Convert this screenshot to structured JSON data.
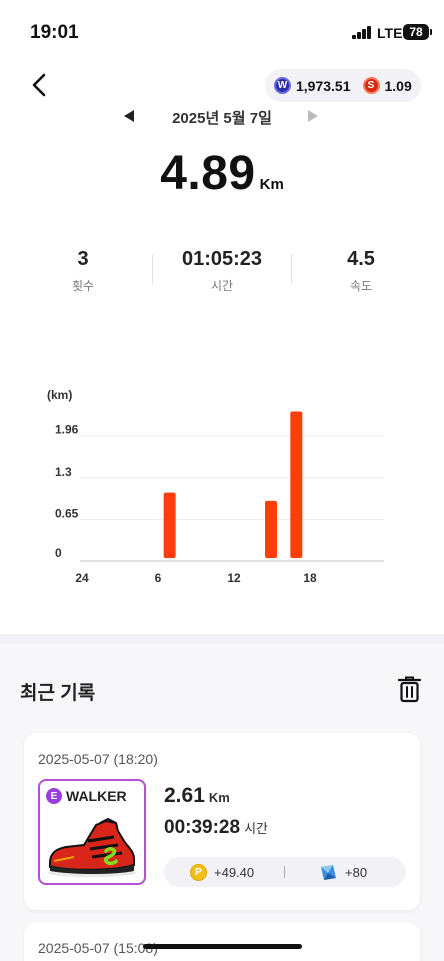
{
  "status_bar": {
    "time": "19:01",
    "network": "LTE",
    "battery": "78"
  },
  "wallet": {
    "w_icon": "W",
    "w_balance": "1,973.51",
    "s_icon": "S",
    "s_balance": "1.09"
  },
  "date_nav": {
    "date": "2025년 5월 7일"
  },
  "summary": {
    "distance": "4.89",
    "distance_unit": "Km"
  },
  "stats": [
    {
      "value": "3",
      "label": "횟수"
    },
    {
      "value": "01:05:23",
      "label": "시간"
    },
    {
      "value": "4.5",
      "label": "속도"
    }
  ],
  "chart_data": {
    "type": "bar",
    "ylabel": "(km)",
    "yticks": [
      "0",
      "0.65",
      "1.3",
      "1.96"
    ],
    "xticks": [
      "24",
      "6",
      "12",
      "18"
    ],
    "ylim": [
      0,
      2.3
    ],
    "xlim": [
      0,
      24
    ],
    "x": [
      7,
      15,
      17
    ],
    "values": [
      1.07,
      0.94,
      2.34
    ],
    "color": "#ff3d0a",
    "grid": true
  },
  "recent": {
    "title": "최근 기록",
    "records": [
      {
        "datetime": "2025-05-07 (18:20)",
        "badge_letter": "E",
        "badge_label": "WALKER",
        "distance": "2.61",
        "distance_unit": "Km",
        "duration": "00:39:28",
        "duration_unit": "시간",
        "reward_p_icon": "P",
        "reward_p": "+49.40",
        "reward_gem": "+80"
      },
      {
        "datetime": "2025-05-07 (15:08)"
      }
    ]
  },
  "colors": {
    "accent": "#ff3d0a",
    "badge_purple": "#b64fd6",
    "coin_yellow": "#f3c014"
  }
}
